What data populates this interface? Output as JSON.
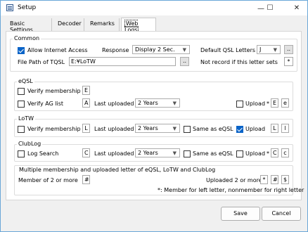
{
  "window": {
    "title": "Setup",
    "minimize": "—",
    "maximize": "☐",
    "close": "✕"
  },
  "tabs": [
    "Basic Settings",
    "Decoder",
    "Remarks",
    "Web Logs"
  ],
  "common": {
    "label": "Common",
    "allow_internet": {
      "label": "Allow Internet Access",
      "checked": true
    },
    "response_label": "Response",
    "response_value": "Display 2 Sec.",
    "default_qsl_label": "Default QSL Letters",
    "default_qsl_value": "J",
    "file_path_label": "File Path of TQSL",
    "file_path_value": "E:¥LoTW",
    "browse": "..",
    "not_record_label": "Not record if this letter sets",
    "not_record_value": "*"
  },
  "eqsl": {
    "label": "eQSL",
    "verify_membership": {
      "label": "Verify membership",
      "letter": "E"
    },
    "verify_ag": {
      "label": "Verify AG list",
      "letter": "A"
    },
    "last_uploaded_label": "Last uploaded",
    "last_uploaded_value": "2 Years",
    "upload_label": "Upload",
    "upload_star": "*",
    "upload_letter1": "E",
    "upload_letter2": "e"
  },
  "lotw": {
    "label": "LoTW",
    "verify_membership": {
      "label": "Verify membership",
      "letter": "L"
    },
    "last_uploaded_label": "Last uploaded",
    "last_uploaded_value": "2 Years",
    "same_as_eqsl": "Same as eQSL",
    "upload_label": "Upload",
    "upload_checked": true,
    "upload_letter1": "L",
    "upload_letter2": "l"
  },
  "clublog": {
    "label": "ClubLog",
    "log_search": {
      "label": "Log Search",
      "letter": "C"
    },
    "last_uploaded_label": "Last uploaded",
    "last_uploaded_value": "2 Years",
    "same_as_eqsl": "Same as eQSL",
    "upload_label": "Upload",
    "upload_star": "*",
    "upload_letter1": "C",
    "upload_letter2": "c"
  },
  "multi": {
    "label": "Multiple membership and uploaded letter of eQSL, LoTW and ClubLog",
    "member_label": "Member of 2 or more",
    "member_value": "#",
    "uploaded_label": "Uploaded 2 or more",
    "uploaded_star": "*",
    "uploaded_hash": "#",
    "uploaded_dollar": "$",
    "note": "*: Member for left letter, nonmember for right letter"
  },
  "buttons": {
    "save": "Save",
    "cancel": "Cancel"
  }
}
